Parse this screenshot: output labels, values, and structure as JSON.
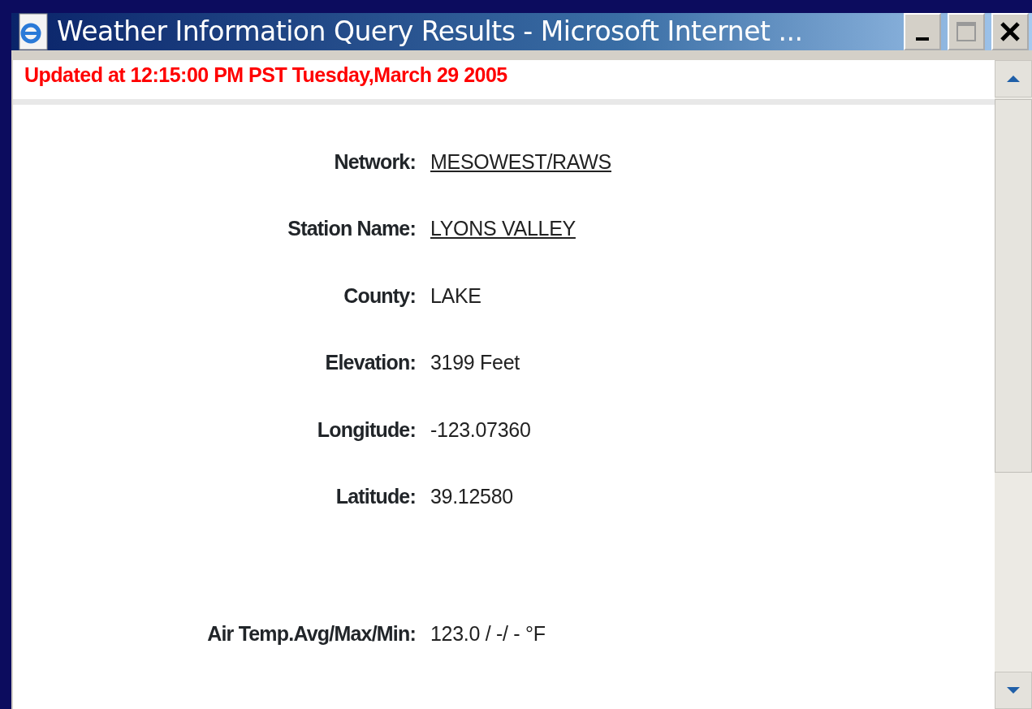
{
  "window": {
    "title": "Weather Information Query Results - Microsoft Internet ..."
  },
  "updated": "Updated at 12:15:00 PM PST Tuesday,March 29 2005",
  "fields": [
    {
      "label": "Network:",
      "value": "MESOWEST/RAWS",
      "kind": "link"
    },
    {
      "label": "Station Name:",
      "value": "LYONS VALLEY",
      "kind": "link"
    },
    {
      "label": "County:",
      "value": "LAKE",
      "kind": "text"
    },
    {
      "label": "Elevation:",
      "value": "3199 Feet",
      "kind": "text"
    },
    {
      "label": "Longitude:",
      "value": "-123.07360",
      "kind": "text"
    },
    {
      "label": "Latitude:",
      "value": "39.12580",
      "kind": "text"
    },
    {
      "label": "Air Temp.Avg/Max/Min:",
      "value": "123.0 / -/ - °F",
      "kind": "text",
      "gap": true
    }
  ]
}
